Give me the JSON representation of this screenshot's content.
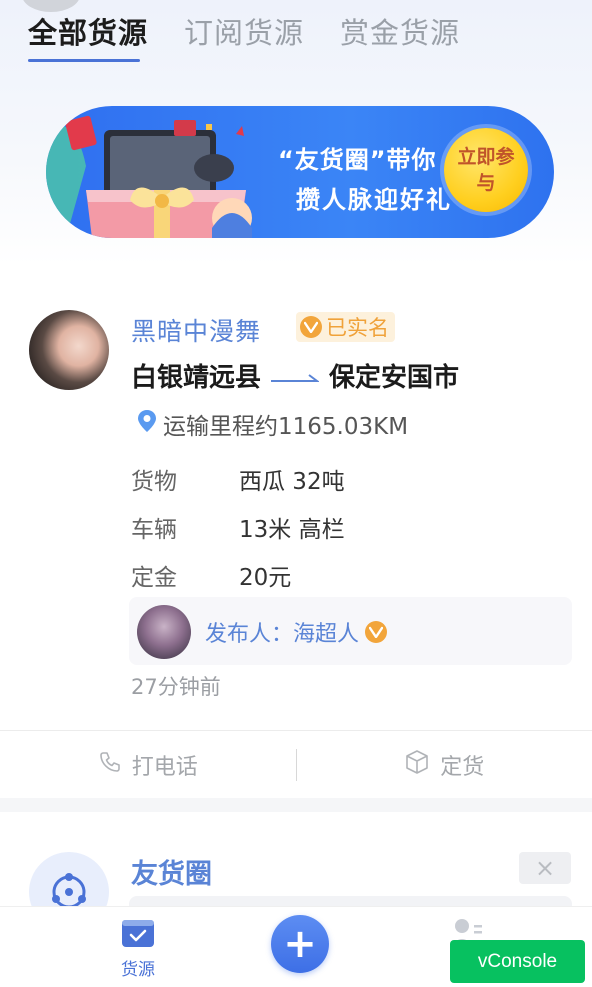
{
  "tabs": [
    {
      "label": "全部货源",
      "active": true
    },
    {
      "label": "订阅货源",
      "active": false
    },
    {
      "label": "赏金货源",
      "active": false
    }
  ],
  "banner": {
    "title": "“友货圈”带你",
    "subtitle": "攒人脉迎好礼",
    "button": "立即参与"
  },
  "listing": {
    "user_name": "黑暗中漫舞",
    "verified_label": "已实名",
    "origin": "白银靖远县",
    "destination": "保定安国市",
    "distance": "运输里程约1165.03KM",
    "rows": [
      {
        "key": "货物",
        "value": "西瓜 32吨"
      },
      {
        "key": "车辆",
        "value": "13米 高栏"
      },
      {
        "key": "定金",
        "value": "20元"
      }
    ],
    "publisher_label": "发布人：海超人",
    "time_ago": "27分钟前",
    "call_label": "打电话",
    "order_label": "定货"
  },
  "second_card": {
    "user_name": "友货圈",
    "close_symbol": "×"
  },
  "tabbar": {
    "home_label": "货源",
    "add_symbol": "+",
    "me_label": "我"
  },
  "vconsole": "vConsole",
  "colors": {
    "accent": "#4a72d6",
    "verified": "#f0a23a",
    "vconsole": "#07c160"
  }
}
